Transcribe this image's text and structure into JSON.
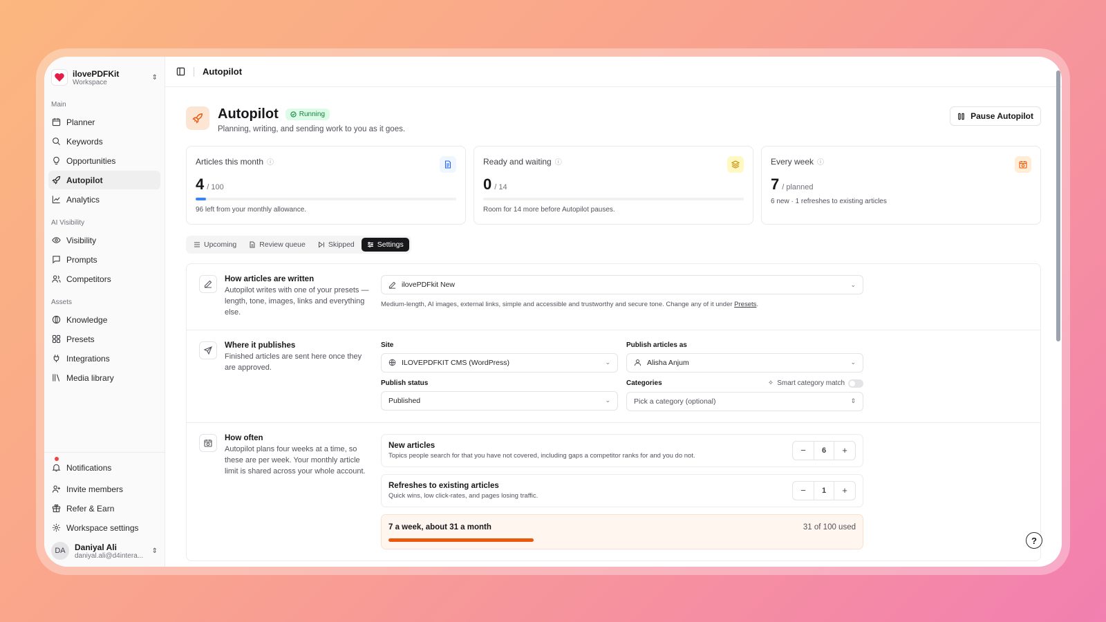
{
  "workspace": {
    "name": "ilovePDFKit",
    "sub": "Workspace"
  },
  "sidebar": {
    "sections": [
      {
        "label": "Main",
        "items": [
          "Planner",
          "Keywords",
          "Opportunities",
          "Autopilot",
          "Analytics"
        ]
      },
      {
        "label": "AI Visibility",
        "items": [
          "Visibility",
          "Prompts",
          "Competitors"
        ]
      },
      {
        "label": "Assets",
        "items": [
          "Knowledge",
          "Presets",
          "Integrations",
          "Media library"
        ]
      }
    ],
    "bottom": [
      "Notifications",
      "Invite members",
      "Refer & Earn",
      "Workspace settings"
    ]
  },
  "user": {
    "initials": "DA",
    "name": "Daniyal Ali",
    "email": "daniyal.ali@d4intera..."
  },
  "topbar": {
    "title": "Autopilot"
  },
  "header": {
    "title": "Autopilot",
    "status": "Running",
    "subtitle": "Planning, writing, and sending work to you as it goes.",
    "pause_label": "Pause Autopilot"
  },
  "cards": [
    {
      "title": "Articles this month",
      "value": "4",
      "of": "/ 100",
      "progress": 0.04,
      "foot": "96 left from your monthly allowance."
    },
    {
      "title": "Ready and waiting",
      "value": "0",
      "of": "/ 14",
      "progress": 0,
      "foot": "Room for 14 more before Autopilot pauses."
    },
    {
      "title": "Every week",
      "value": "7",
      "of": "/ planned",
      "foot": "6 new · 1 refreshes to existing articles"
    }
  ],
  "tabs": [
    "Upcoming",
    "Review queue",
    "Skipped",
    "Settings"
  ],
  "written": {
    "title": "How articles are written",
    "text": "Autopilot writes with one of your presets — length, tone, images, links and everything else.",
    "preset": "ilovePDFkit New",
    "hint": "Medium-length, AI images, external links, simple and accessible and trustworthy and secure tone. Change any of it under ",
    "hint_link": "Presets",
    "hint_end": "."
  },
  "publishes": {
    "title": "Where it publishes",
    "text": "Finished articles are sent here once they are approved.",
    "site_label": "Site",
    "site_value": "ILOVEPDFKIT CMS (WordPress)",
    "as_label": "Publish articles as",
    "as_value": "Alisha Anjum",
    "status_label": "Publish status",
    "status_value": "Published",
    "cat_label": "Categories",
    "smart_label": "Smart category match",
    "cat_placeholder": "Pick a category (optional)"
  },
  "often": {
    "title": "How often",
    "text": "Autopilot plans four weeks at a time, so these are per week. Your monthly article limit is shared across your whole account.",
    "new_title": "New articles",
    "new_text": "Topics people search for that you have not covered, including gaps a competitor ranks for and you do not.",
    "new_value": "6",
    "ref_title": "Refreshes to existing articles",
    "ref_text": "Quick wins, low click-rates, and pages losing traffic.",
    "ref_value": "1",
    "summary_left": "7 a week, about 31 a month",
    "summary_right": "31 of 100 used",
    "summary_progress": 0.31
  },
  "colors": {
    "accent": "#ea580c",
    "running": "#15803d",
    "progress": "#3b82f6"
  }
}
